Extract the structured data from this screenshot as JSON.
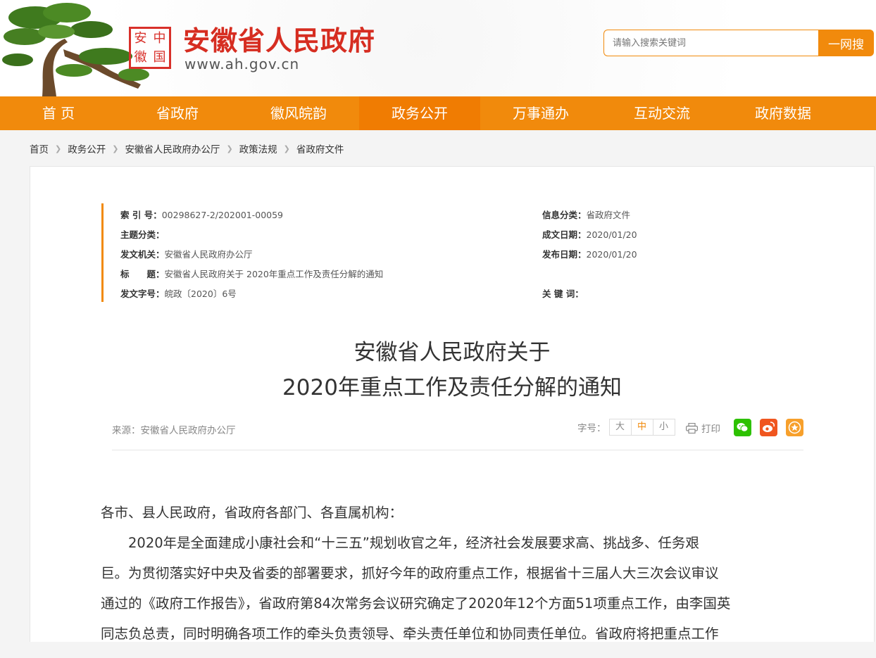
{
  "header": {
    "seal_chars": [
      "安",
      "中",
      "徽",
      "国"
    ],
    "site_title": "安徽省人民政府",
    "site_url": "www.ah.gov.cn",
    "search_placeholder": "请输入搜索关键词",
    "search_button": "一网搜"
  },
  "nav": {
    "items": [
      "首 页",
      "省政府",
      "徽风皖韵",
      "政务公开",
      "万事通办",
      "互动交流",
      "政府数据"
    ],
    "active_index": 3
  },
  "breadcrumb": [
    "首页",
    "政务公开",
    "安徽省人民政府办公厅",
    "政策法规",
    "省政府文件"
  ],
  "meta": {
    "index_label": "索 引 号：",
    "index_value": "00298627-2/202001-00059",
    "category_label": "信息分类：",
    "category_value": "省政府文件",
    "topic_label": "主题分类：",
    "topic_value": "",
    "written_label": "成文日期：",
    "written_value": "2020/01/20",
    "issuer_label": "发文机关：",
    "issuer_value": "安徽省人民政府办公厅",
    "published_label": "发布日期：",
    "published_value": "2020/01/20",
    "title_label": "标　　题：",
    "title_value": "安徽省人民政府关于 2020年重点工作及责任分解的通知",
    "docno_label": "发文字号：",
    "docno_value": "皖政〔2020〕6号",
    "keywords_label": "关 键 词：",
    "keywords_value": ""
  },
  "document": {
    "title_line1": "安徽省人民政府关于",
    "title_line2": "2020年重点工作及责任分解的通知",
    "source": "来源：安徽省人民政府办公厅",
    "font_size_label": "字号：",
    "font_sizes": [
      "大",
      "中",
      "小"
    ],
    "font_size_selected": "中",
    "print_label": "打印",
    "share_icons": [
      "wechat-icon",
      "weibo-icon",
      "favorite-icon"
    ],
    "share_colors": [
      "#2dc100",
      "#f0561f",
      "#f7a02c"
    ],
    "salutation": "各市、县人民政府，省政府各部门、各直属机构：",
    "paragraph_lines": [
      "2020年是全面建成小康社会和“十三五”规划收官之年，经济社会发展要求高、挑战多、任务艰",
      "巨。为贯彻落实好中央及省委的部署要求，抓好今年的政府重点工作，根据省十三届人大三次会议审议",
      "通过的《政府工作报告》，省政府第84次常务会议研究确定了2020年12个方面51项重点工作，由李国英",
      "同志负总责，同时明确各项工作的牵头负责领导、牵头责任单位和协同责任单位。省政府将把重点工作"
    ]
  },
  "colors": {
    "brand_orange": "#f18a0c",
    "title_red": "#d62d21"
  }
}
